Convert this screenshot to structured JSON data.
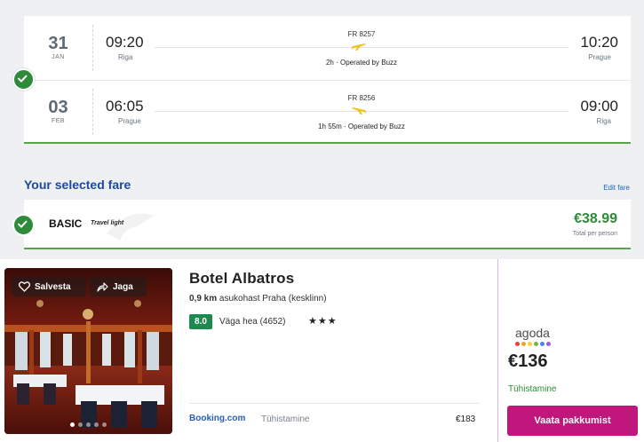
{
  "flights": [
    {
      "day": "31",
      "month": "JAN",
      "dep_time": "09:20",
      "dep_city": "Riga",
      "arr_time": "10:20",
      "arr_city": "Prague",
      "flight_no": "FR 8257",
      "meta": "2h · Operated by Buzz"
    },
    {
      "day": "03",
      "month": "FEB",
      "dep_time": "06:05",
      "dep_city": "Prague",
      "arr_time": "09:00",
      "arr_city": "Riga",
      "flight_no": "FR 8256",
      "meta": "1h 55m · Operated by Buzz"
    }
  ],
  "fare": {
    "heading": "Your selected fare",
    "edit_label": "Edit fare",
    "name": "BASIC",
    "tag": "Travel light",
    "price": "€38.99",
    "price_note": "Total per person"
  },
  "hotel": {
    "save_label": "Salvesta",
    "share_label": "Jaga",
    "name": "Botel Albatros",
    "distance_value": "0,9 km",
    "distance_rest": " asukohast Praha (kesklinn)",
    "rating": "8.0",
    "rating_text": "Väga hea (4652)",
    "stars": "★★★",
    "provider": "Booking.com",
    "provider_cancel": "Tühistamine",
    "provider_price": "€183",
    "deal": {
      "logo": "agoda",
      "price": "€136",
      "cancel": "Tühistamine",
      "button": "Vaata pakkumist"
    }
  },
  "colors": {
    "accent_green": "#2e8b3a",
    "heading_blue": "#1c4aa1",
    "deal_button": "#c0177c",
    "rating_badge": "#1c8a4e"
  },
  "icons": {
    "check": "check-circle-icon",
    "plane": "plane-icon",
    "heart": "heart-icon",
    "share": "share-icon"
  }
}
